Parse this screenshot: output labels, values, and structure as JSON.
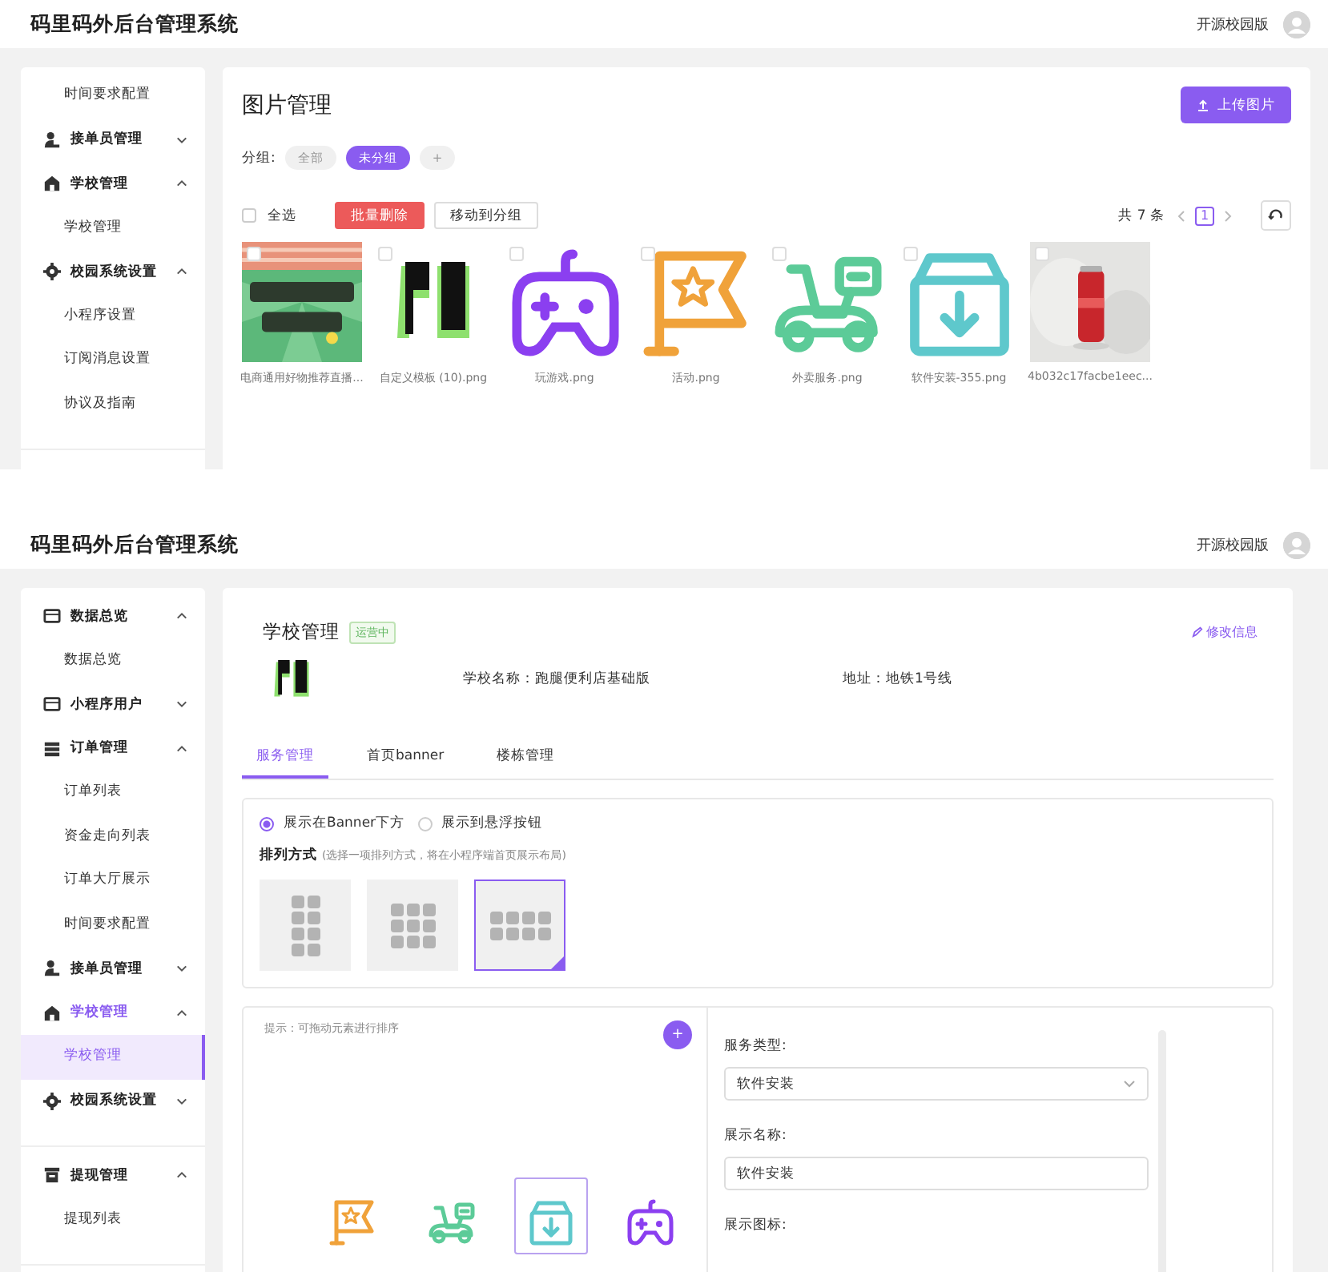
{
  "upper_screen": {
    "header": {
      "title": "码里码外后台管理系统",
      "edition": "开源校园版"
    },
    "sidebar": {
      "sections": [
        {
          "items": [
            {
              "label": "时间要求配置",
              "kind": "item",
              "selected": false
            },
            {
              "label": "接单员管理",
              "kind": "group",
              "expanded": false
            },
            {
              "label": "学校管理",
              "kind": "group",
              "expanded": true,
              "children": [
                {
                  "label": "学校管理",
                  "selected": false
                }
              ]
            },
            {
              "label": "校园系统设置",
              "kind": "group",
              "expanded": true,
              "children": [
                {
                  "label": "小程序设置",
                  "selected": false
                },
                {
                  "label": "订阅消息设置",
                  "selected": false
                },
                {
                  "label": "协议及指南",
                  "selected": false
                }
              ]
            }
          ]
        }
      ]
    },
    "gallery": {
      "title": "图片管理",
      "upload_button": "上传图片",
      "group_label": "分组:",
      "groups": [
        {
          "label": "全部",
          "selected": false
        },
        {
          "label": "未分组",
          "selected": true
        }
      ],
      "add_group": "+",
      "select_all": {
        "label": "全选",
        "checked": false
      },
      "actions": [
        {
          "label": "批量删除",
          "kind": "danger"
        },
        {
          "label": "移动到分组",
          "kind": "default"
        }
      ],
      "total": "共 7 条",
      "pages": [
        {
          "label": "1",
          "selected": true
        }
      ],
      "images": [
        {
          "name": "电商通用好物推荐直播...",
          "kind": "picture",
          "checked": false
        },
        {
          "name": "自定义模板 (10).png",
          "kind": "picture",
          "checked": false
        },
        {
          "name": "玩游戏.png",
          "kind": "gamepad",
          "color": "#8b3ff0",
          "checked": false
        },
        {
          "name": "活动.png",
          "kind": "flag",
          "color": "#f0a23a",
          "checked": false
        },
        {
          "name": "外卖服务.png",
          "kind": "scooter",
          "color": "#5ccb98",
          "checked": false
        },
        {
          "name": "软件安装-355.png",
          "kind": "download",
          "color": "#5ec8cc",
          "checked": false
        },
        {
          "name": "4b032c17facbe1eec...",
          "kind": "picture",
          "checked": false
        }
      ]
    }
  },
  "lower_screen": {
    "header": {
      "title": "码里码外后台管理系统",
      "edition": "开源校园版"
    },
    "sidebar": {
      "sections": [
        {
          "items": [
            {
              "label": "数据总览",
              "kind": "group",
              "expanded": true,
              "children": [
                {
                  "label": "数据总览",
                  "selected": false
                }
              ]
            },
            {
              "label": "小程序用户",
              "kind": "group",
              "expanded": false
            },
            {
              "label": "订单管理",
              "kind": "group",
              "expanded": true,
              "children": [
                {
                  "label": "订单列表",
                  "selected": false
                },
                {
                  "label": "资金走向列表",
                  "selected": false
                },
                {
                  "label": "订单大厅展示",
                  "selected": false
                },
                {
                  "label": "时间要求配置",
                  "selected": false
                }
              ]
            },
            {
              "label": "接单员管理",
              "kind": "group",
              "expanded": false
            },
            {
              "label": "学校管理",
              "kind": "group",
              "expanded": true,
              "children": [
                {
                  "label": "学校管理",
                  "selected": true
                }
              ]
            },
            {
              "label": "校园系统设置",
              "kind": "group",
              "expanded": false
            }
          ]
        },
        {
          "items": [
            {
              "label": "提现管理",
              "kind": "group",
              "expanded": true,
              "children": [
                {
                  "label": "提现列表",
                  "selected": false
                }
              ]
            }
          ]
        }
      ]
    },
    "school": {
      "title": "学校管理",
      "status": "运营中",
      "edit_link": "修改信息",
      "name": "学校名称：跑腿便利店基础版",
      "address": "地址：地铁1号线",
      "tabs": [
        {
          "label": "服务管理",
          "selected": true
        },
        {
          "label": "首页banner",
          "selected": false
        },
        {
          "label": "楼栋管理",
          "selected": false
        }
      ],
      "display_options": [
        {
          "label": "展示在Banner下方",
          "selected": true
        },
        {
          "label": "展示到悬浮按钮",
          "selected": false
        }
      ],
      "layout_title": "排列方式",
      "layout_hint": "(选择一项排列方式，将在小程序端首页展示布局)",
      "layouts": [
        {
          "kind": "two",
          "selected": false
        },
        {
          "kind": "three",
          "selected": false
        },
        {
          "kind": "four",
          "selected": true
        }
      ],
      "sort_hint": "提示：可拖动元素进行排序",
      "add_button": "+",
      "services": [
        {
          "kind": "flag",
          "color": "#f0a23a",
          "selected": false
        },
        {
          "kind": "scooter",
          "color": "#5ccb98",
          "selected": false
        },
        {
          "kind": "download",
          "color": "#5ec8cc",
          "selected": true
        },
        {
          "kind": "gamepad",
          "color": "#8b3ff0",
          "selected": false
        }
      ],
      "form": {
        "type_label": "服务类型:",
        "type_value": "软件安装",
        "name_label": "展示名称:",
        "name_value": "软件安装",
        "icon_label": "展示图标:"
      }
    }
  }
}
